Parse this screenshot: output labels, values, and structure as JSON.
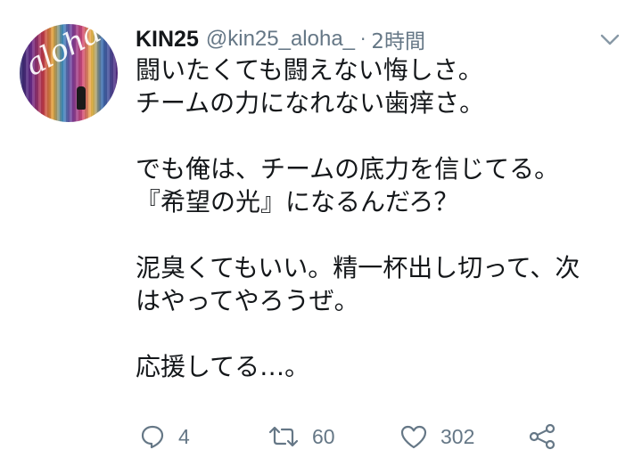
{
  "tweet": {
    "author_name": "KIN25",
    "handle": "@kin25_aloha_",
    "separator": "·",
    "time": "2時間",
    "avatar_text": "aloha",
    "lines": [
      "闘いたくても闘えない悔しさ。",
      "チームの力になれない歯痒さ。",
      "",
      "でも俺は、チームの底力を信じてる。",
      "『希望の光』になるんだろ？",
      "",
      "泥臭くてもいい。精一杯出し切って、次",
      "はやってやろうぜ。",
      "",
      "応援してる…。"
    ]
  },
  "actions": {
    "reply_count": "4",
    "retweet_count": "60",
    "like_count": "302"
  },
  "icons": {
    "reply": "reply-icon",
    "retweet": "retweet-icon",
    "like": "heart-icon",
    "share": "share-icon",
    "menu": "chevron-down-icon"
  },
  "colors": {
    "text": "#14171a",
    "secondary": "#657786",
    "background": "#ffffff"
  }
}
